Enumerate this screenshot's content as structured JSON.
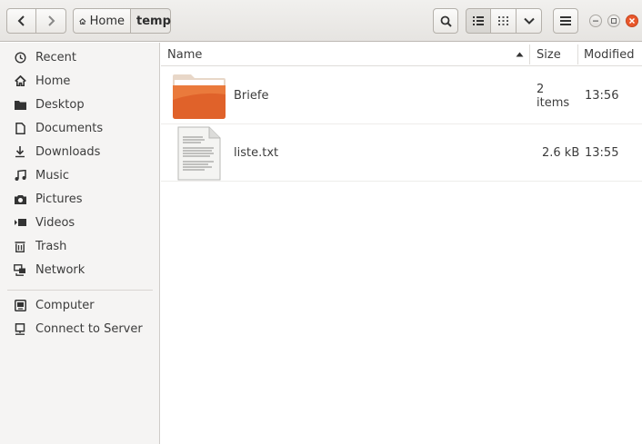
{
  "toolbar": {
    "back_icon": "chevron-left-icon",
    "forward_icon": "chevron-right-icon",
    "path": [
      {
        "label": "Home",
        "icon": "home-icon"
      },
      {
        "label": "temp"
      }
    ],
    "search_icon": "search-icon",
    "view_list_icon": "list-view-icon",
    "view_grid_icon": "grid-view-icon",
    "view_options_icon": "chevron-down-icon",
    "menu_icon": "hamburger-menu-icon",
    "window_controls": [
      "minimize",
      "maximize",
      "close"
    ],
    "accent": "#e9572b"
  },
  "sidebar": {
    "items": [
      {
        "label": "Recent",
        "icon": "clock-icon"
      },
      {
        "label": "Home",
        "icon": "home-icon"
      },
      {
        "label": "Desktop",
        "icon": "folder-icon"
      },
      {
        "label": "Documents",
        "icon": "document-icon"
      },
      {
        "label": "Downloads",
        "icon": "download-icon"
      },
      {
        "label": "Music",
        "icon": "music-icon"
      },
      {
        "label": "Pictures",
        "icon": "camera-icon"
      },
      {
        "label": "Videos",
        "icon": "video-icon"
      },
      {
        "label": "Trash",
        "icon": "trash-icon"
      },
      {
        "label": "Network",
        "icon": "network-icon"
      }
    ],
    "devices": [
      {
        "label": "Computer",
        "icon": "computer-icon"
      },
      {
        "label": "Connect to Server",
        "icon": "server-icon"
      }
    ]
  },
  "files": {
    "columns": {
      "name": "Name",
      "size": "Size",
      "modified": "Modified",
      "sort_icon": "sort-ascending-icon"
    },
    "rows": [
      {
        "name": "Briefe",
        "size": "2 items",
        "modified": "13:56",
        "icon": "folder-icon"
      },
      {
        "name": "liste.txt",
        "size": "2.6 kB",
        "modified": "13:55",
        "icon": "text-file-icon"
      }
    ]
  }
}
